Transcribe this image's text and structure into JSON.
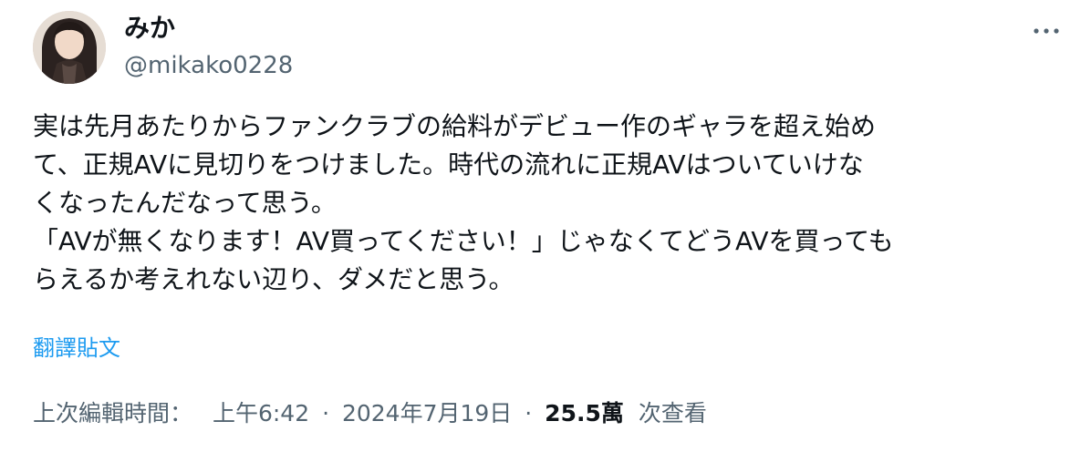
{
  "user": {
    "display_name": "みか",
    "handle": "@mikako0228",
    "avatar": "profile-photo"
  },
  "tweet": {
    "lines": [
      "実は先月あたりからファンクラブの給料がデビュー作のギャラを超え始め",
      "て、正規AVに見切りをつけました。時代の流れに正規AVはついていけな",
      "くなったんだなって思う。",
      "「AVが無くなります！AV買ってください！」じゃなくてどうAVを買っても",
      "らえるか考えれない辺り、ダメだと思う。"
    ],
    "translate_label": "翻譯貼文"
  },
  "meta": {
    "edited_label": "上次編輯時間：",
    "time": "上午6:42",
    "separator": "·",
    "date": "2024年7月19日",
    "views_count": "25.5萬",
    "views_label": "次查看"
  },
  "icons": {
    "more": "more-horizontal-icon"
  },
  "colors": {
    "text": "#0f1419",
    "secondary": "#536471",
    "link": "#1d9bf0"
  }
}
